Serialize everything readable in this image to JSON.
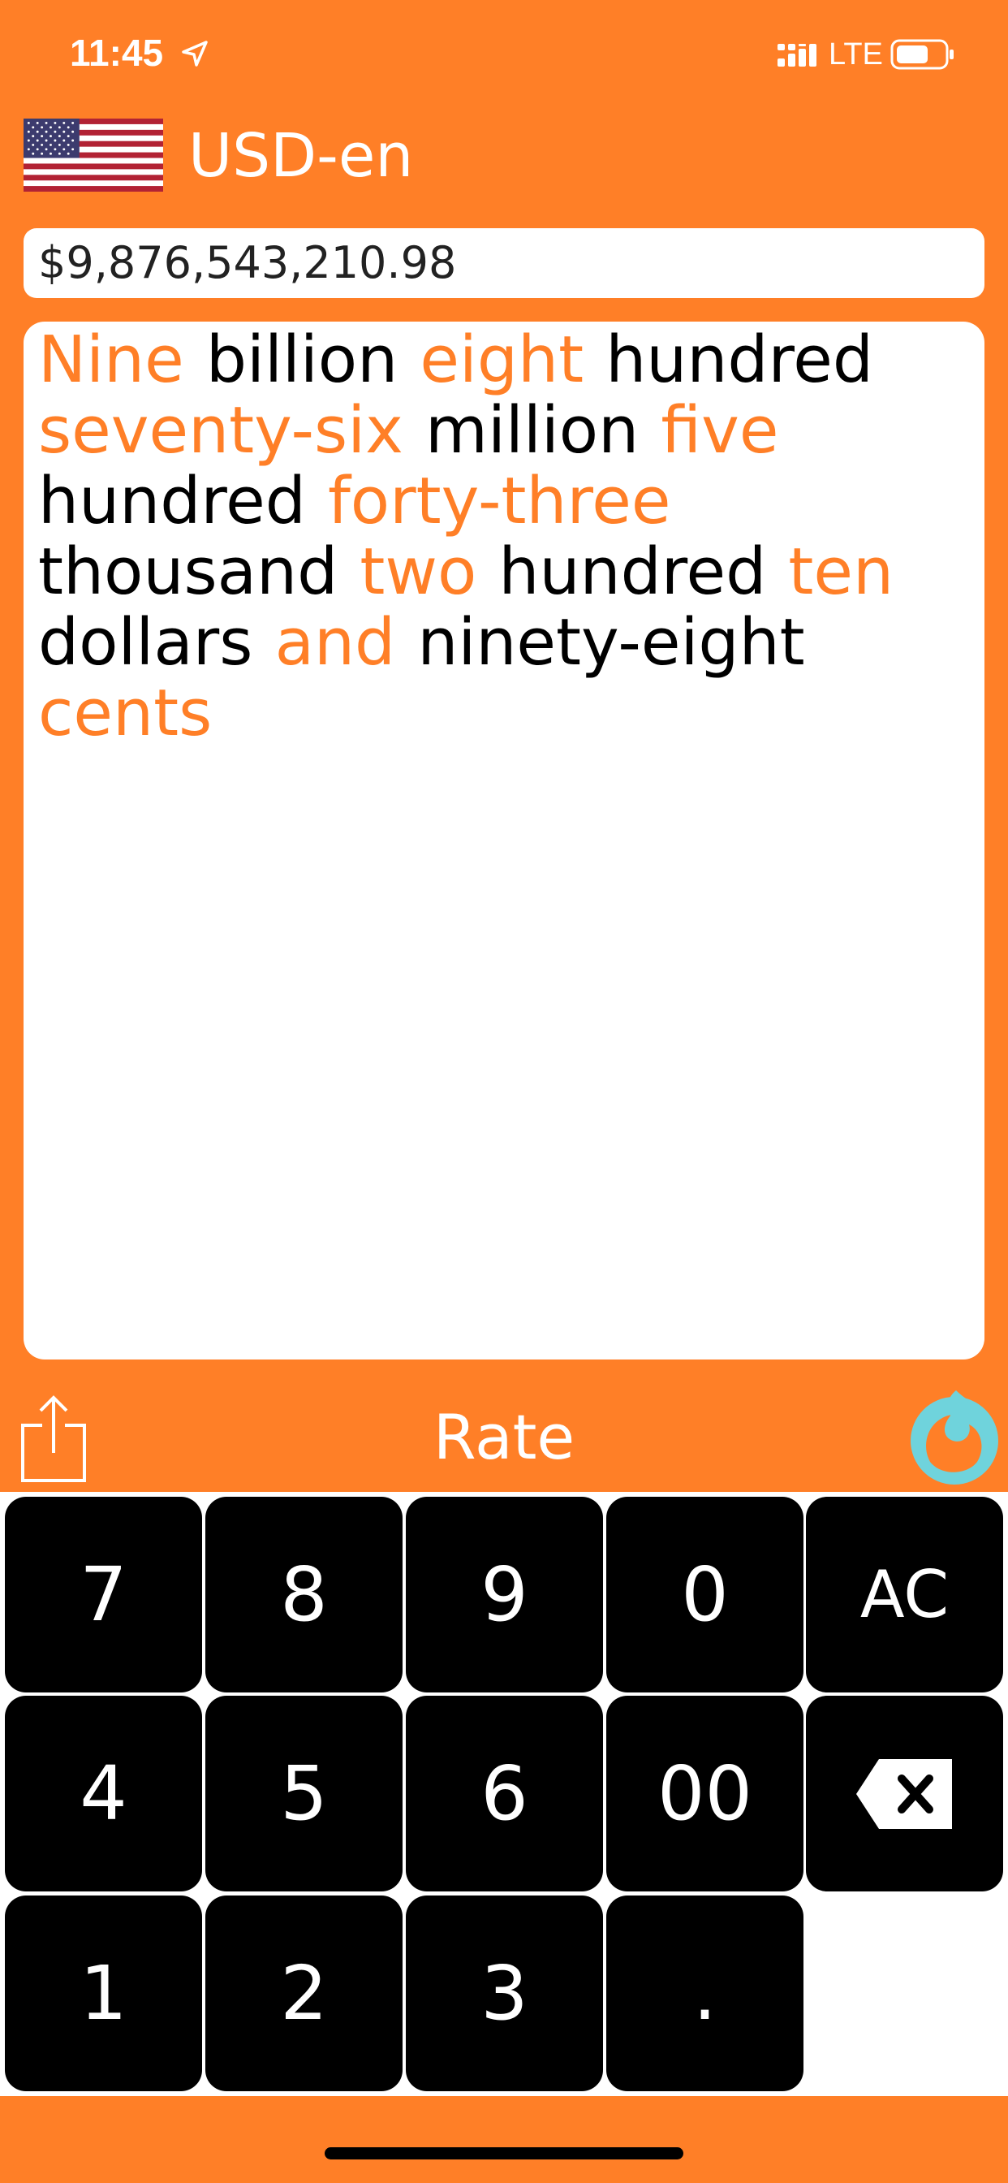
{
  "status_bar": {
    "time": "11:45",
    "network": "LTE",
    "icons": [
      "location-arrow-icon",
      "signal-bars-icon",
      "battery-icon"
    ]
  },
  "header": {
    "flag": "us-flag-icon",
    "locale": "USD-en"
  },
  "input": {
    "amount": "$9,876,543,210.98"
  },
  "words": [
    {
      "text": "Nine",
      "accent": true
    },
    {
      "text": "billion",
      "accent": false
    },
    {
      "text": "eight",
      "accent": true
    },
    {
      "text": "hundred",
      "accent": false
    },
    {
      "text": "seventy-six",
      "accent": true
    },
    {
      "text": "million",
      "accent": false
    },
    {
      "text": "five",
      "accent": true
    },
    {
      "text": "hundred",
      "accent": false
    },
    {
      "text": "forty-three",
      "accent": true
    },
    {
      "text": "thousand",
      "accent": false
    },
    {
      "text": "two",
      "accent": true
    },
    {
      "text": "hundred",
      "accent": false
    },
    {
      "text": "ten",
      "accent": true
    },
    {
      "text": "dollars",
      "accent": false
    },
    {
      "text": "and",
      "accent": true
    },
    {
      "text": "ninety-eight",
      "accent": false
    },
    {
      "text": "cents",
      "accent": true
    }
  ],
  "actions": {
    "share_icon": "share-icon",
    "rate_label": "Rate",
    "logo_icon": "phoenix-logo-icon"
  },
  "keypad": {
    "rows": [
      [
        "7",
        "8",
        "9",
        "0",
        "AC"
      ],
      [
        "4",
        "5",
        "6",
        "00",
        "backspace"
      ],
      [
        "1",
        "2",
        "3",
        "."
      ]
    ]
  },
  "colors": {
    "background": "#FF7F27",
    "accent_word": "#FF7F27",
    "key_background": "#000000",
    "logo": "#6FD3DC"
  }
}
